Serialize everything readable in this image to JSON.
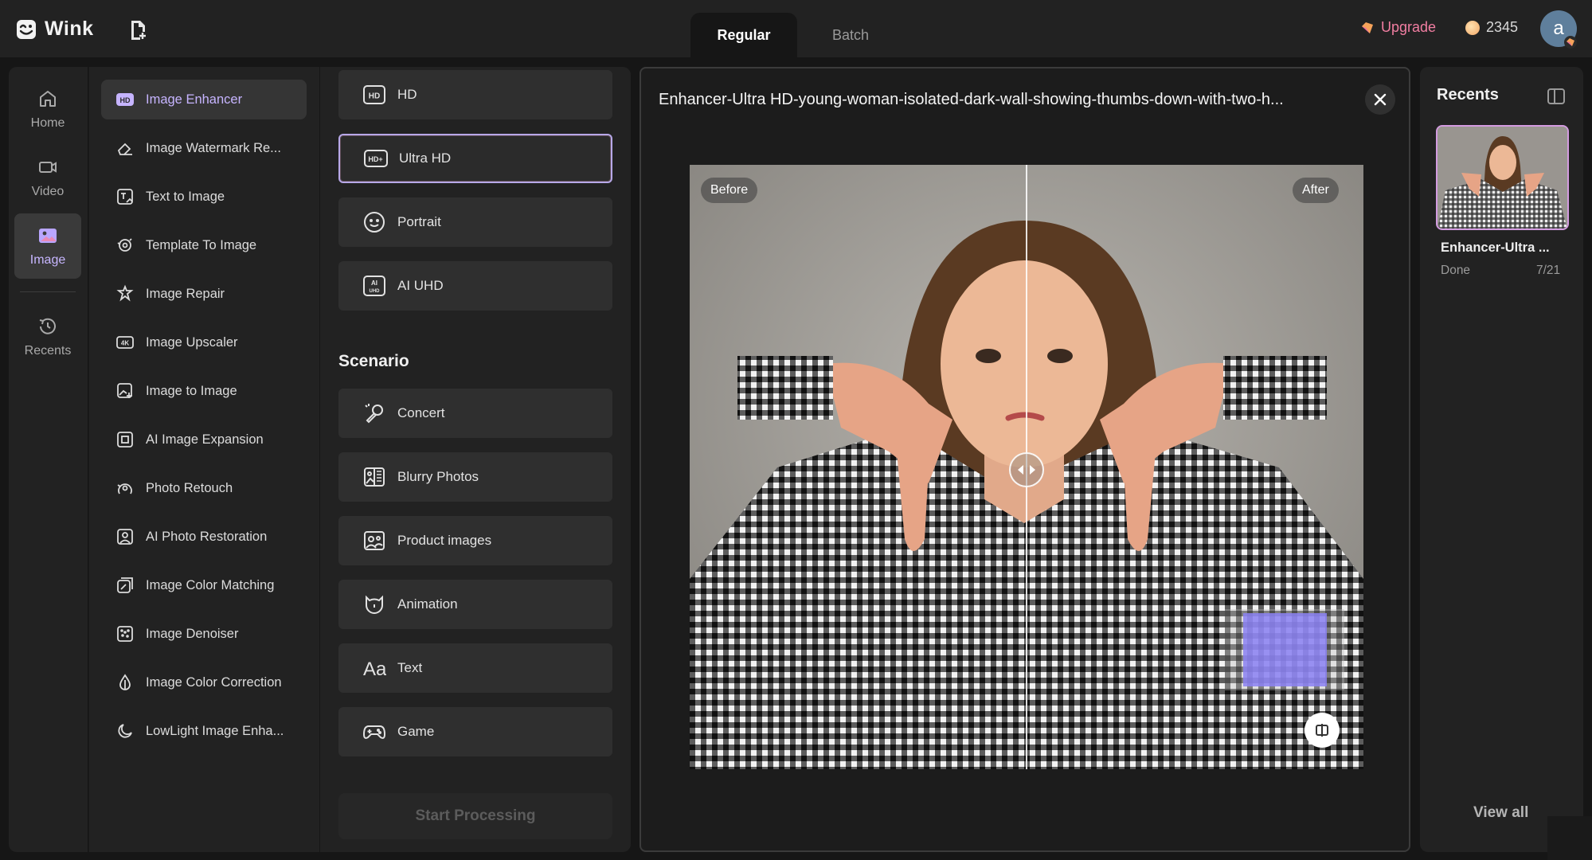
{
  "app": {
    "name": "Wink"
  },
  "header": {
    "tabs": [
      {
        "label": "Regular",
        "active": true
      },
      {
        "label": "Batch",
        "active": false
      }
    ],
    "upgrade_label": "Upgrade",
    "coins": "2345",
    "avatar_letter": "a"
  },
  "nav": {
    "items": [
      {
        "label": "Home",
        "icon": "home-icon"
      },
      {
        "label": "Video",
        "icon": "video-icon"
      },
      {
        "label": "Image",
        "icon": "image-icon",
        "active": true
      },
      {
        "label": "Recents",
        "icon": "history-icon"
      }
    ]
  },
  "tools": {
    "items": [
      {
        "label": "Image Enhancer",
        "icon": "hd-badge-icon",
        "active": true
      },
      {
        "label": "Image Watermark Re...",
        "icon": "eraser-icon"
      },
      {
        "label": "Text to Image",
        "icon": "text-image-icon"
      },
      {
        "label": "Template To Image",
        "icon": "template-icon"
      },
      {
        "label": "Image Repair",
        "icon": "repair-icon"
      },
      {
        "label": "Image Upscaler",
        "icon": "4k-icon"
      },
      {
        "label": "Image to Image",
        "icon": "image-to-image-icon"
      },
      {
        "label": "AI Image Expansion",
        "icon": "expand-icon"
      },
      {
        "label": "Photo Retouch",
        "icon": "retouch-icon"
      },
      {
        "label": "AI Photo Restoration",
        "icon": "restoration-icon"
      },
      {
        "label": "Image Color Matching",
        "icon": "color-match-icon"
      },
      {
        "label": "Image Denoiser",
        "icon": "denoise-icon"
      },
      {
        "label": "Image Color Correction",
        "icon": "color-correct-icon"
      },
      {
        "label": "LowLight Image Enha...",
        "icon": "moon-icon"
      }
    ]
  },
  "options": {
    "quality": [
      {
        "label": "HD",
        "icon": "hd-icon"
      },
      {
        "label": "Ultra HD",
        "icon": "hd-plus-icon",
        "selected": true
      },
      {
        "label": "Portrait",
        "icon": "face-icon"
      },
      {
        "label": "AI UHD",
        "icon": "ai-uhd-icon"
      }
    ],
    "scenario_title": "Scenario",
    "scenarios": [
      {
        "label": "Concert",
        "icon": "microphone-icon"
      },
      {
        "label": "Blurry Photos",
        "icon": "blurry-icon"
      },
      {
        "label": "Product images",
        "icon": "product-icon"
      },
      {
        "label": "Animation",
        "icon": "animation-icon"
      },
      {
        "label": "Text",
        "icon": "text-icon"
      },
      {
        "label": "Game",
        "icon": "gamepad-icon"
      }
    ],
    "start_label": "Start Processing"
  },
  "preview": {
    "title": "Enhancer-Ultra HD-young-woman-isolated-dark-wall-showing-thumbs-down-with-two-h...",
    "before_label": "Before",
    "after_label": "After"
  },
  "recents": {
    "title": "Recents",
    "items": [
      {
        "name": "Enhancer-Ultra ...",
        "status": "Done",
        "date": "7/21"
      }
    ],
    "view_all_label": "View all"
  },
  "colors": {
    "accent_purple": "#c6b4ff",
    "upgrade_pink": "#f27ea2",
    "panel_bg": "#222222",
    "page_bg": "#161616"
  }
}
